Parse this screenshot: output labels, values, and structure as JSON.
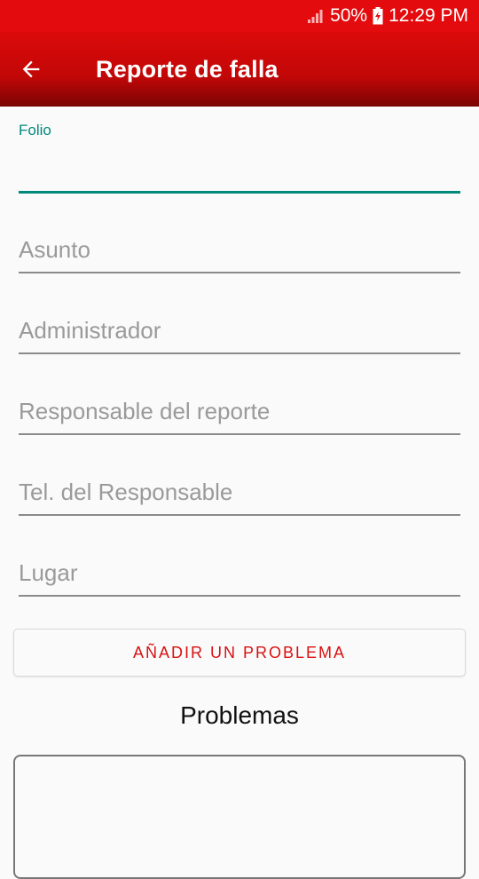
{
  "status_bar": {
    "battery": "50%",
    "time": "12:29 PM",
    "icons": [
      "signal-icon",
      "battery-charging-icon"
    ]
  },
  "app_bar": {
    "title": "Reporte de falla",
    "back_icon": "arrow-left-icon"
  },
  "form": {
    "folio": {
      "label": "Folio",
      "value": ""
    },
    "fields": [
      {
        "placeholder": "Asunto",
        "value": ""
      },
      {
        "placeholder": "Administrador",
        "value": ""
      },
      {
        "placeholder": "Responsable del reporte",
        "value": ""
      },
      {
        "placeholder": "Tel. del Responsable",
        "value": ""
      },
      {
        "placeholder": "Lugar",
        "value": ""
      }
    ]
  },
  "add_button": {
    "label": "AÑADIR UN PROBLEMA"
  },
  "problems": {
    "title": "Problemas"
  },
  "colors": {
    "primary": "#e30b0e",
    "accent": "#00897b",
    "button_text": "#d81212"
  }
}
